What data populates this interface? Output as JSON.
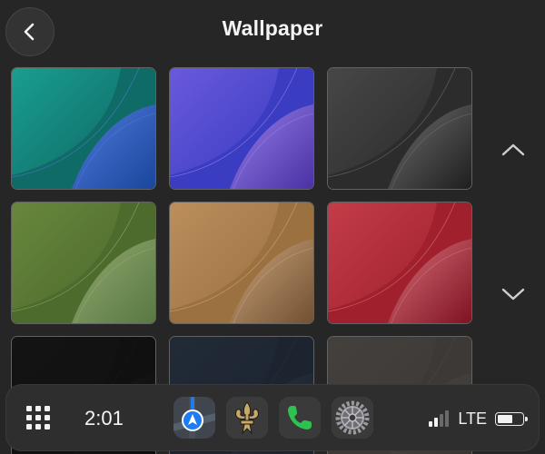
{
  "header": {
    "back_icon": "chevron-left-icon",
    "title": "Wallpaper"
  },
  "wallpapers": [
    {
      "name": "teal-blue",
      "bg": "#0f6b66",
      "wave1": "#1ba394",
      "wave2": "#1d3fa6",
      "sheen": "#5b7ff0"
    },
    {
      "name": "indigo-purple",
      "bg": "#3a3cc2",
      "wave1": "#6f5de0",
      "wave2": "#4e2f9e",
      "sheen": "#a58cf2"
    },
    {
      "name": "graphite",
      "bg": "#2c2c2c",
      "wave1": "#4a4a4a",
      "wave2": "#1c1c1c",
      "sheen": "#7a7a7a"
    },
    {
      "name": "olive-green",
      "bg": "#4d6b2c",
      "wave1": "#6b8a3e",
      "wave2": "#5a7a46",
      "sheen": "#9fb47c"
    },
    {
      "name": "bronze",
      "bg": "#9c7140",
      "wave1": "#bf9260",
      "wave2": "#6b4a2e",
      "sheen": "#d2ae88"
    },
    {
      "name": "crimson",
      "bg": "#a1202e",
      "wave1": "#c7404c",
      "wave2": "#7a1020",
      "sheen": "#e07f86"
    },
    {
      "name": "black",
      "bg": "#101010",
      "wave1": "#141414",
      "wave2": "#0c0c0c",
      "sheen": "#1a1a1a"
    },
    {
      "name": "navy",
      "bg": "#1c2430",
      "wave1": "#222b38",
      "wave2": "#19202a",
      "sheen": "#2a3442"
    },
    {
      "name": "warm-gray",
      "bg": "#3d3936",
      "wave1": "#45413e",
      "wave2": "#37332f",
      "sheen": "#4d4946"
    }
  ],
  "scroll": {
    "up_icon": "chevron-up-icon",
    "down_icon": "chevron-down-icon"
  },
  "dock": {
    "apps_icon": "app-grid-icon",
    "time": "2:01",
    "apps": [
      {
        "name": "maps",
        "icon": "navigation-arrow-icon",
        "color": "#1e7cf2"
      },
      {
        "name": "saints",
        "icon": "fleur-de-lis-icon",
        "color": "#c8a866"
      },
      {
        "name": "phone",
        "icon": "phone-icon",
        "color": "#2fc14f"
      },
      {
        "name": "settings",
        "icon": "gear-icon",
        "color": "#8e8e93"
      }
    ],
    "status": {
      "signal_bars": 2,
      "signal_max": 4,
      "network": "LTE",
      "battery_level": 0.65
    }
  }
}
